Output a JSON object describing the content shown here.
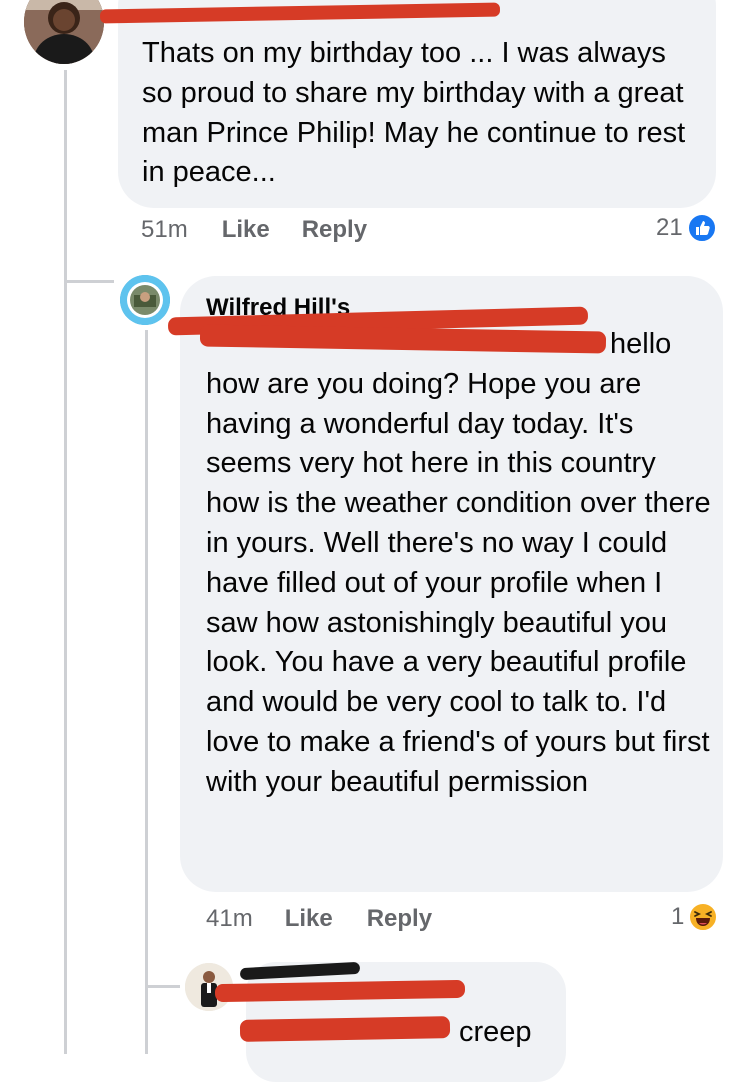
{
  "comment1": {
    "text": "Thats on my birthday too ... I was always so proud to share my birthday with a great man Prince Philip! May he continue to rest in peace...",
    "time": "51m",
    "like_label": "Like",
    "reply_label": "Reply",
    "reaction_count": "21",
    "reaction_icon": "like-icon"
  },
  "reply1": {
    "author": "Wilfred Hill's",
    "text": "hello how are you doing? Hope you are having a wonderful day today. It's seems very hot here in this country how is the weather condition over there in yours. Well there's no way I could have filled out of your profile when I saw how astonishingly beautiful you look. You have a very beautiful profile and would be very cool to talk to. I'd love to make a friend's of yours but first with your beautiful permission",
    "time": "41m",
    "like_label": "Like",
    "reply_label": "Reply",
    "reaction_count": "1",
    "reaction_icon": "haha-icon"
  },
  "reply2": {
    "text": "creep"
  },
  "colors": {
    "bubble": "#f0f2f5",
    "meta_text": "#65676b",
    "like_blue": "#1877f2",
    "haha_yellow": "#f7b125",
    "redaction_red": "#d63b26"
  }
}
